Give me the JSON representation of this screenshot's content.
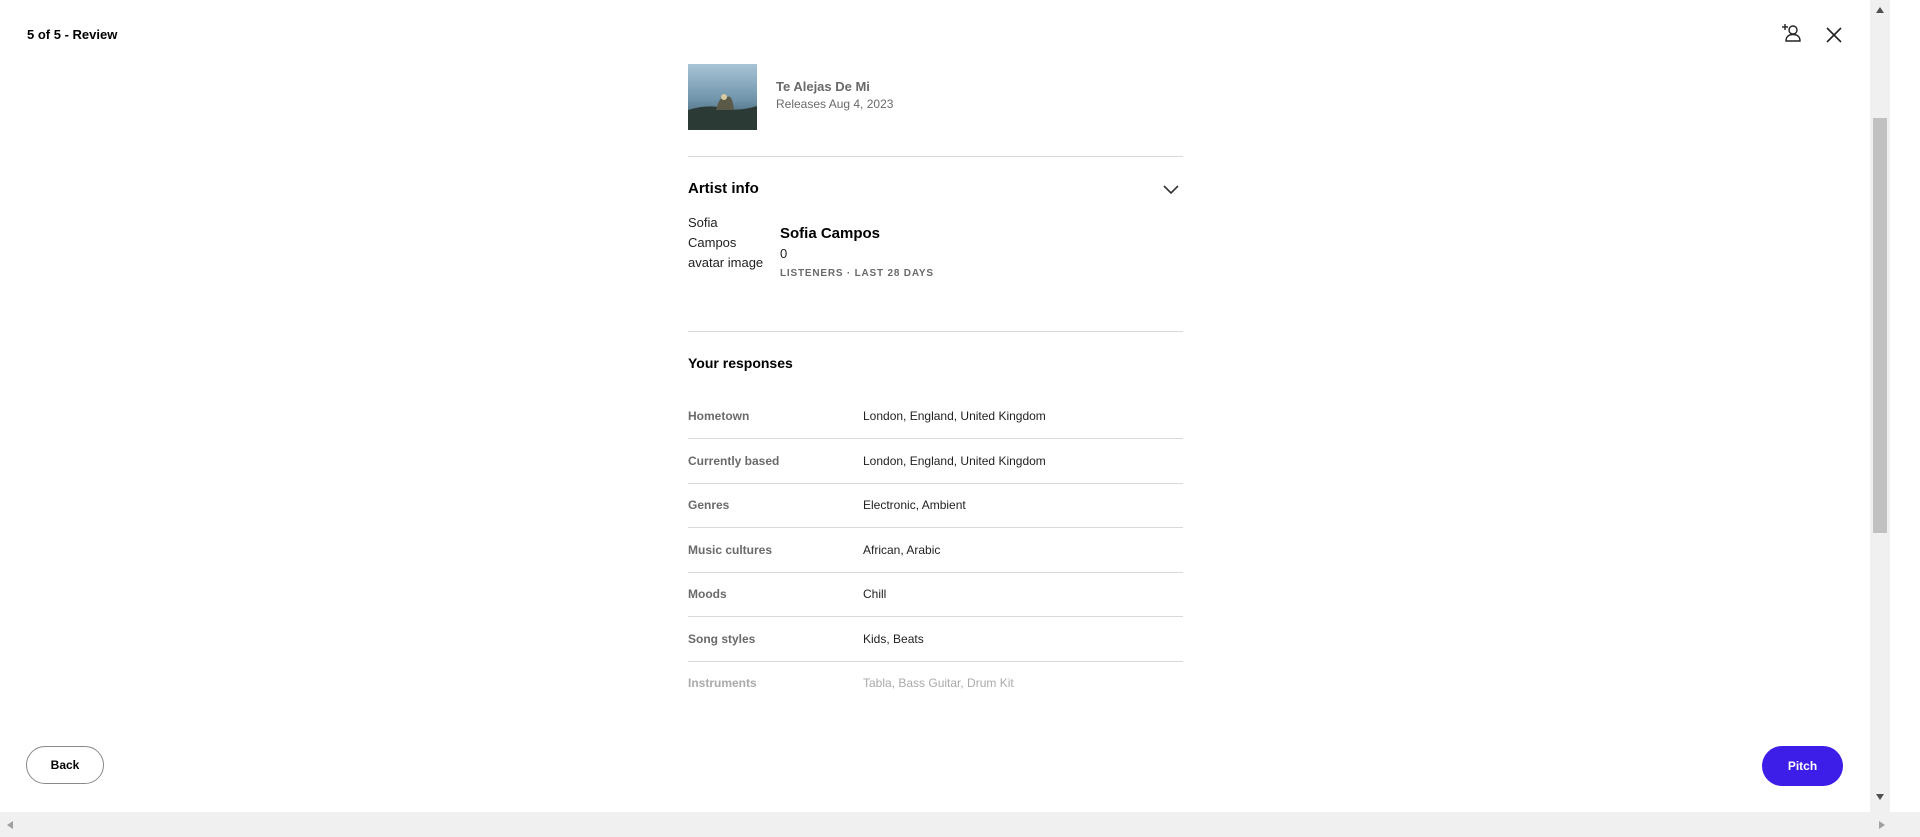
{
  "header": {
    "step": "5 of 5 - Review"
  },
  "release": {
    "title": "Te Alejas De Mi",
    "date": "Releases Aug 4, 2023"
  },
  "artist_info": {
    "heading": "Artist info",
    "avatar_alt": "Sofia\nCampos\navatar image",
    "name": "Sofia Campos",
    "listeners": "0",
    "listeners_label": "LISTENERS · LAST 28 DAYS"
  },
  "responses": {
    "heading": "Your responses",
    "rows": [
      {
        "label": "Hometown",
        "value": "London, England, United Kingdom"
      },
      {
        "label": "Currently based",
        "value": "London, England, United Kingdom"
      },
      {
        "label": "Genres",
        "value": "Electronic, Ambient"
      },
      {
        "label": "Music cultures",
        "value": "African, Arabic"
      },
      {
        "label": "Moods",
        "value": "Chill"
      },
      {
        "label": "Song styles",
        "value": "Kids, Beats"
      },
      {
        "label": "Instruments",
        "value": "Tabla, Bass Guitar, Drum Kit"
      }
    ]
  },
  "footer": {
    "back_label": "Back",
    "pitch_label": "Pitch"
  },
  "colors": {
    "accent": "#3d1de8",
    "muted_text": "#6a6a6a",
    "divider": "#d9d9d9"
  },
  "icons": {
    "invite": "add-person-icon",
    "close": "close-icon",
    "expand": "chevron-down-icon"
  }
}
